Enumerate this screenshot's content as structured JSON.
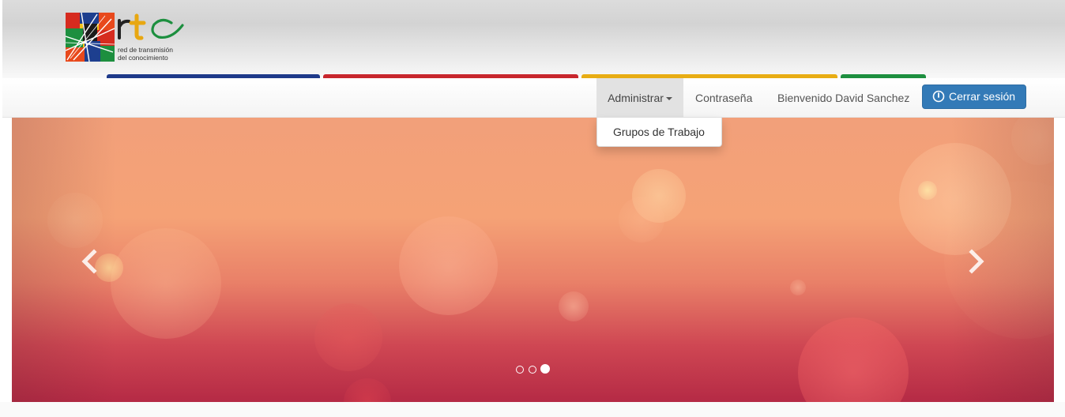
{
  "brand": {
    "logo_letters": "rtc",
    "tagline_line1": "red de transmisión",
    "tagline_line2": "del conocimiento"
  },
  "color_bars": [
    "#1f3a8a",
    "#c8262d",
    "#e8ad14",
    "#1d8f3f"
  ],
  "navbar": {
    "admin_label": "Administrar",
    "password_label": "Contraseña",
    "welcome_text": "Bienvenido David Sanchez",
    "logout_label": "Cerrar sesión",
    "logout_icon": "power-icon",
    "dropdown_items": [
      "Grupos de Trabajo"
    ]
  },
  "carousel": {
    "prev_icon": "chevron-left-icon",
    "next_icon": "chevron-right-icon",
    "slide_count": 3,
    "active_slide": 3
  },
  "colors": {
    "primary": "#337ab7",
    "carousel_top": "#f2a07a",
    "carousel_bottom": "#b52a45"
  }
}
